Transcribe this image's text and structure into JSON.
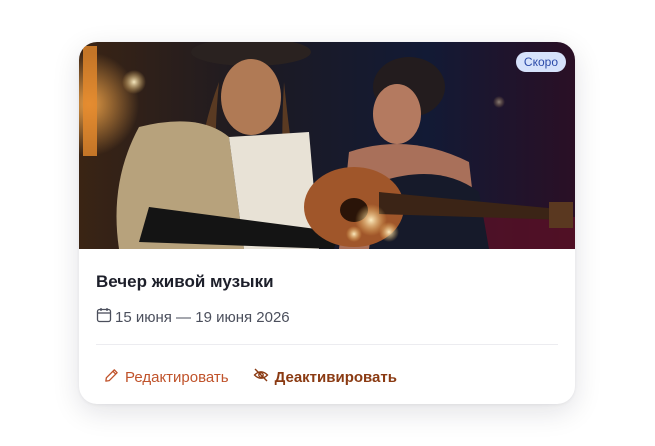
{
  "card": {
    "badge": "Скоро",
    "title": "Вечер живой музыки",
    "dates": "15 июня — 19 июня 2026",
    "date_icon": "calendar-icon",
    "image_alt": "event-photo"
  },
  "actions": {
    "edit_label": "Редактировать",
    "edit_icon": "pencil-icon",
    "deactivate_label": "Деактивировать",
    "deactivate_icon": "eye-off-icon"
  },
  "colors": {
    "badge_bg": "#d6e2fb",
    "badge_text": "#2b4aa8",
    "edit": "#c0532b",
    "deactivate": "#8a3a12"
  }
}
